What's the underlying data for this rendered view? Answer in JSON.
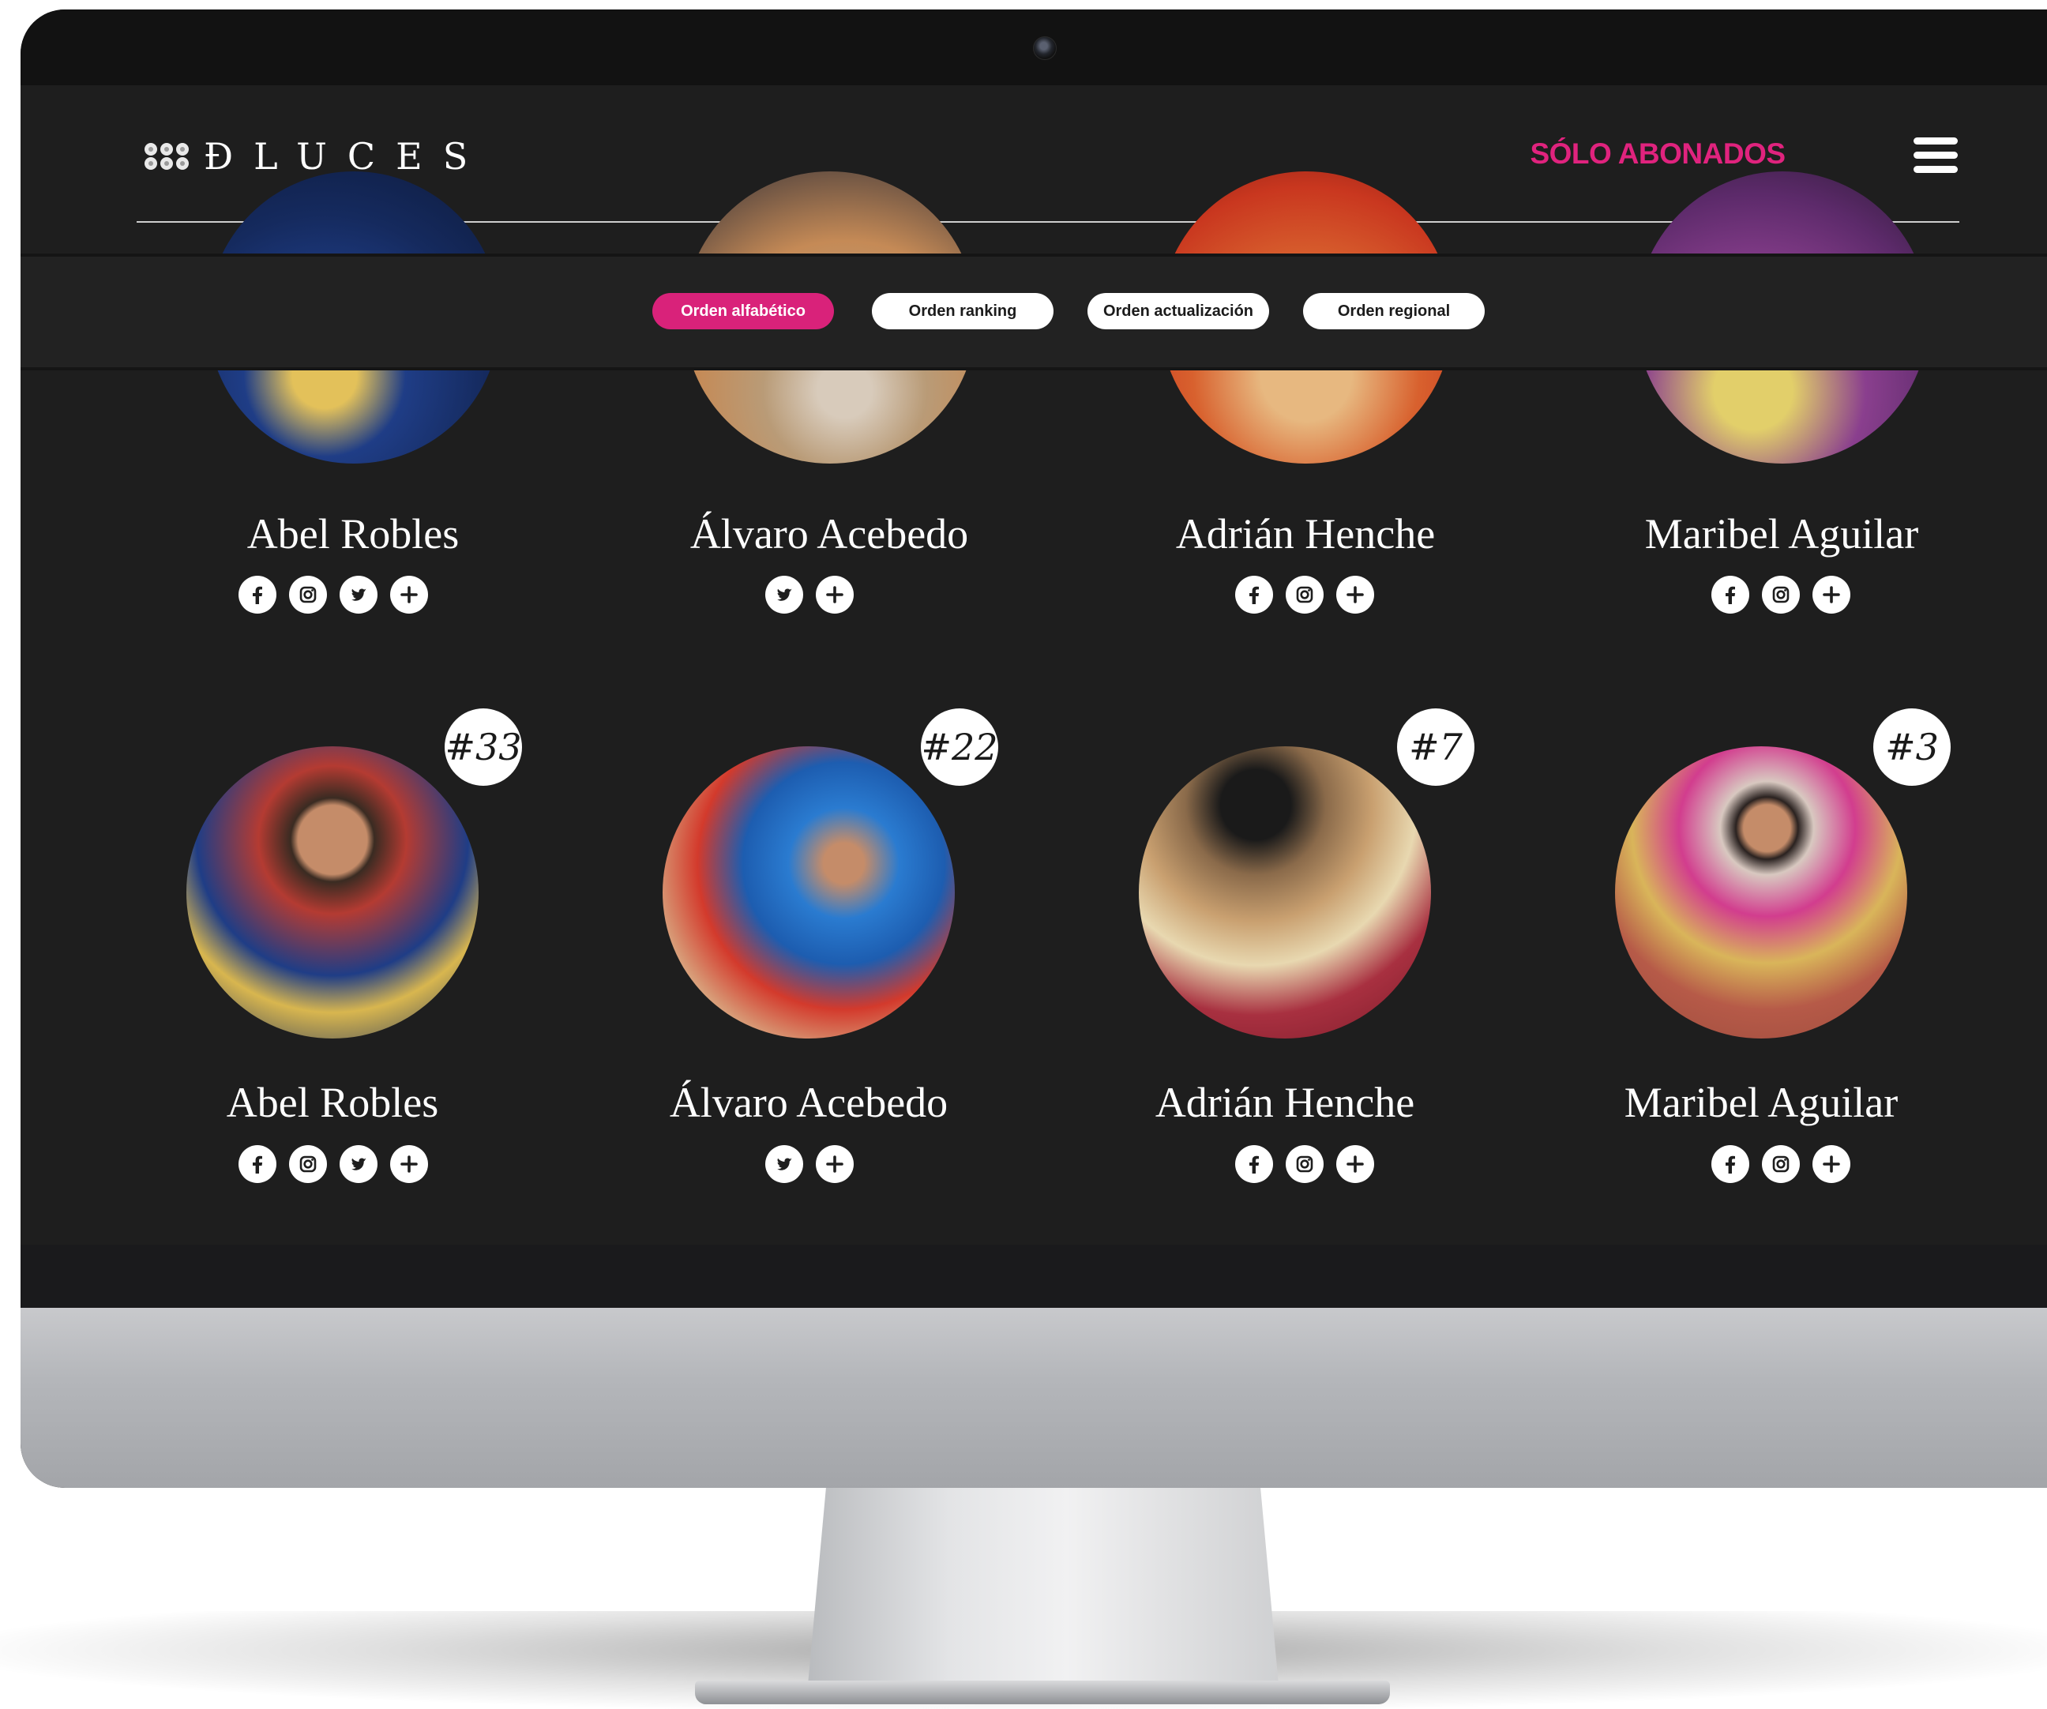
{
  "brand": {
    "logo_text": "ÐLUCES"
  },
  "header": {
    "subscribers_link": "SÓLO ABONADOS"
  },
  "filters": [
    {
      "label": "Orden alfabético",
      "active": true
    },
    {
      "label": "Orden ranking",
      "active": false
    },
    {
      "label": "Orden actualización",
      "active": false
    },
    {
      "label": "Orden regional",
      "active": false
    }
  ],
  "colors": {
    "accent": "#e0237e",
    "background": "#1e1e1e",
    "text": "#ffffff"
  },
  "rows": [
    {
      "cards": [
        {
          "name": "Abel Robles",
          "rank": "",
          "socials": [
            "facebook-icon",
            "instagram-icon",
            "twitter-icon",
            "plus-icon"
          ]
        },
        {
          "name": "Álvaro Acebedo",
          "rank": "",
          "socials": [
            "twitter-icon",
            "plus-icon"
          ]
        },
        {
          "name": "Adrián Henche",
          "rank": "",
          "socials": [
            "facebook-icon",
            "instagram-icon",
            "plus-icon"
          ]
        },
        {
          "name": "Maribel Aguilar",
          "rank": "",
          "socials": [
            "facebook-icon",
            "instagram-icon",
            "plus-icon"
          ]
        }
      ]
    },
    {
      "cards": [
        {
          "name": "Abel Robles",
          "rank": "#33",
          "socials": [
            "facebook-icon",
            "instagram-icon",
            "twitter-icon",
            "plus-icon"
          ]
        },
        {
          "name": "Álvaro Acebedo",
          "rank": "#22",
          "socials": [
            "twitter-icon",
            "plus-icon"
          ]
        },
        {
          "name": "Adrián Henche",
          "rank": "#7",
          "socials": [
            "facebook-icon",
            "instagram-icon",
            "plus-icon"
          ]
        },
        {
          "name": "Maribel Aguilar",
          "rank": "#3",
          "socials": [
            "facebook-icon",
            "instagram-icon",
            "plus-icon"
          ]
        }
      ]
    }
  ]
}
